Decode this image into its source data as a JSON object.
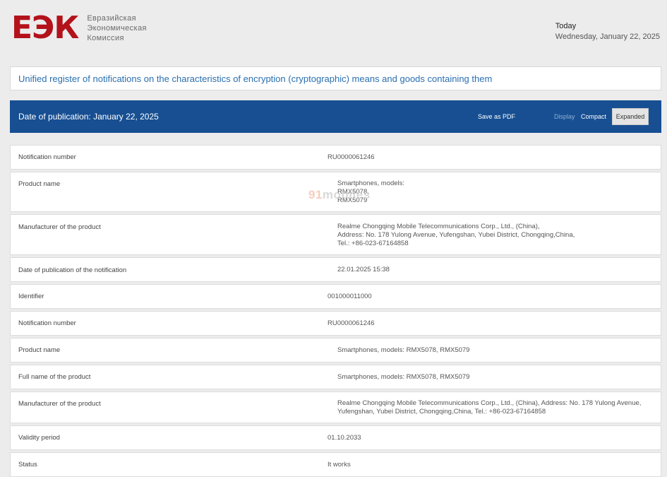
{
  "header": {
    "logo_mark": "ЕЭК",
    "logo_lines": [
      "Евразийская",
      "Экономическая",
      "Комиссия"
    ],
    "date_label": "Today",
    "date_value": "Wednesday, January 22, 2025"
  },
  "register_title": "Unified register of notifications on the characteristics of encryption (cryptographic) means and goods containing them",
  "publication_bar": {
    "title": "Date of publication: January 22, 2025",
    "save_pdf": "Save as PDF",
    "display_label": "Display",
    "compact_label": "Compact",
    "expanded_label": "Expanded"
  },
  "watermark": {
    "prefix": "91",
    "text": "mobiles"
  },
  "rows": [
    {
      "label": "Notification number",
      "value": [
        "RU0000061246"
      ]
    },
    {
      "label": "Product name",
      "value": [
        "Smartphones, models:",
        "RMX5078,",
        "RMX5079"
      ]
    },
    {
      "label": "Manufacturer of the product",
      "value": [
        "Realme Chongqing Mobile Telecommunications Corp., Ltd., (China),",
        "Address: No. 178 Yulong Avenue, Yufengshan, Yubei District, Chongqing,China,",
        "Tel.: +86-023-67164858"
      ]
    },
    {
      "label": "Date of publication of the notification",
      "value": [
        "22.01.2025 15:38"
      ]
    },
    {
      "label": "Identifier",
      "value": [
        "001000011000"
      ]
    },
    {
      "label": "Notification number",
      "value": [
        "RU0000061246"
      ]
    },
    {
      "label": "Product name",
      "value": [
        "Smartphones, models: RMX5078, RMX5079"
      ]
    },
    {
      "label": "Full name of the product",
      "value": [
        "Smartphones, models: RMX5078, RMX5079"
      ]
    },
    {
      "label": "Manufacturer of the product",
      "value": [
        "Realme Chongqing Mobile Telecommunications Corp., Ltd., (China), Address: No. 178 Yulong Avenue,",
        "Yufengshan, Yubei District, Chongqing,China, Tel.: +86-023-67164858"
      ]
    },
    {
      "label": "Validity period",
      "value": [
        "01.10.2033"
      ]
    },
    {
      "label": "Status",
      "value": [
        "It works"
      ]
    }
  ]
}
